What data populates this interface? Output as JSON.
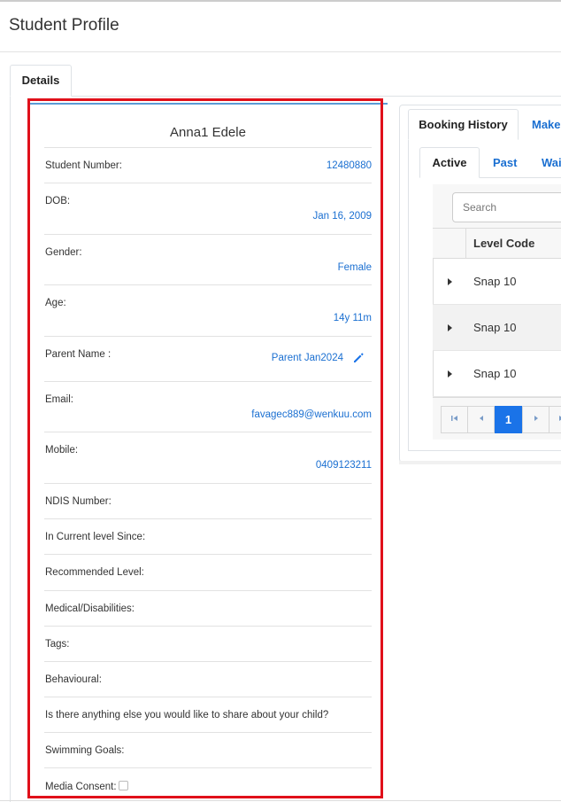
{
  "page": {
    "title": "Student Profile"
  },
  "tabs": {
    "details": "Details"
  },
  "profile": {
    "name": "Anna1 Edele",
    "fields": [
      {
        "label": "Student Number:",
        "value": "12480880"
      },
      {
        "label": "DOB:",
        "value": "Jan 16, 2009"
      },
      {
        "label": "Gender:",
        "value": "Female"
      },
      {
        "label": "Age:",
        "value": "14y 11m"
      },
      {
        "label": "Parent Name :",
        "value": "Parent Jan2024",
        "edit_icon": "pencil-icon"
      },
      {
        "label": "Email:",
        "value": "favagec889@wenkuu.com"
      },
      {
        "label": "Mobile:",
        "value": "0409123211"
      },
      {
        "label": "NDIS Number:",
        "value": ""
      },
      {
        "label": "In Current level Since:",
        "value": ""
      },
      {
        "label": "Recommended Level:",
        "value": ""
      },
      {
        "label": "Medical/Disabilities:",
        "value": ""
      },
      {
        "label": "Tags:",
        "value": ""
      },
      {
        "label": "Behavioural:",
        "value": ""
      },
      {
        "label": "Is there anything else you would like to share about your child?",
        "value": ""
      },
      {
        "label": "Swimming Goals:",
        "value": ""
      },
      {
        "label": "Media Consent:",
        "value": "",
        "checkbox": false
      }
    ]
  },
  "booking_panel": {
    "tabs": [
      "Booking History",
      "Make"
    ],
    "subtabs": [
      "Active",
      "Past",
      "Wai"
    ],
    "search_placeholder": "Search",
    "column_header": "Level Code",
    "rows": [
      {
        "level_code": "Snap 10"
      },
      {
        "level_code": "Snap 10"
      },
      {
        "level_code": "Snap 10"
      }
    ],
    "pager": {
      "current_page": "1"
    }
  },
  "colors": {
    "link": "#1a6fd1",
    "accent": "#1a73e8",
    "highlight_border": "#e0101a",
    "card_top": "#5b9bd5"
  }
}
